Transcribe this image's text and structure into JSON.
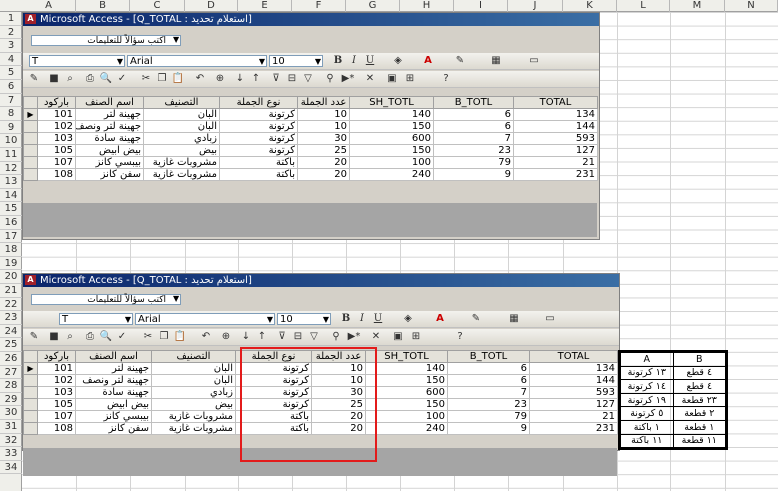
{
  "sheet": {
    "columns": [
      "A",
      "B",
      "C",
      "D",
      "E",
      "F",
      "G",
      "H",
      "I",
      "J",
      "K",
      "L",
      "M",
      "N"
    ],
    "rows": [
      "1",
      "2",
      "3",
      "4",
      "5",
      "6",
      "7",
      "8",
      "9",
      "10",
      "11",
      "12",
      "13",
      "14",
      "15",
      "16",
      "17",
      "18",
      "19",
      "20",
      "21",
      "22",
      "23",
      "24",
      "25",
      "26",
      "27",
      "28",
      "29",
      "30",
      "31",
      "32",
      "33",
      "34"
    ]
  },
  "window1": {
    "title": "Microsoft Access - [Q_TOTAL : استعلام تحديد]",
    "ask_placeholder": "اكتب سؤالاً للتعليمات",
    "font_field": "T",
    "font_name": "Arial",
    "font_size": "10",
    "headers": [
      "باركود",
      "اسم الصنف",
      "التصنيف",
      "نوع الجملة",
      "عدد الجملة",
      "SH_TOTL",
      "B_TOTL",
      "TOTAL"
    ],
    "rows": [
      [
        "101",
        "جهينة لتر",
        "البان",
        "كرتونة",
        "10",
        "140",
        "6",
        "134"
      ],
      [
        "102",
        "جهينة لتر ونصف",
        "البان",
        "كرتونة",
        "10",
        "150",
        "6",
        "144"
      ],
      [
        "103",
        "جهينة سادة",
        "زبادي",
        "كرتونة",
        "30",
        "600",
        "7",
        "593"
      ],
      [
        "105",
        "بيض ابيض",
        "بيض",
        "كرتونة",
        "25",
        "150",
        "23",
        "127"
      ],
      [
        "107",
        "بيبسي كانز",
        "مشروبات غازية",
        "باكتة",
        "20",
        "100",
        "79",
        "21"
      ],
      [
        "108",
        "سفن كانز",
        "مشروبات غازية",
        "باكتة",
        "20",
        "240",
        "9",
        "231"
      ]
    ]
  },
  "window2": {
    "title": "Microsoft Access - [Q_TOTAL : استعلام تحديد]",
    "ask_placeholder": "اكتب سؤالاً للتعليمات",
    "font_field": "T",
    "font_name": "Arial",
    "font_size": "10",
    "headers": [
      "باركود",
      "اسم الصنف",
      "التصنيف",
      "نوع الجملة",
      "عدد الجملة",
      "SH_TOTL",
      "B_TOTL",
      "TOTAL"
    ],
    "rows": [
      [
        "101",
        "جهينة لتر",
        "البان",
        "كرتونة",
        "10",
        "140",
        "6",
        "134"
      ],
      [
        "102",
        "جهينة لتر ونصف",
        "البان",
        "كرتونة",
        "10",
        "150",
        "6",
        "144"
      ],
      [
        "103",
        "جهينة سادة",
        "زبادي",
        "كرتونة",
        "30",
        "600",
        "7",
        "593"
      ],
      [
        "105",
        "بيض ابيض",
        "بيض",
        "كرتونة",
        "25",
        "150",
        "23",
        "127"
      ],
      [
        "107",
        "بيبسي كانز",
        "مشروبات غازية",
        "باكتة",
        "20",
        "100",
        "79",
        "21"
      ],
      [
        "108",
        "سفن كانز",
        "مشروبات غازية",
        "باكتة",
        "20",
        "240",
        "9",
        "231"
      ]
    ]
  },
  "summary_table": {
    "headers": [
      "A",
      "B"
    ],
    "rows": [
      [
        "١٣ كرتونة",
        "٤ قطع"
      ],
      [
        "١٤ كرتونة",
        "٤ قطع"
      ],
      [
        "١٩ كرتونة",
        "٢٣ قطعة"
      ],
      [
        "٥ كرتونة",
        "٢ قطعة"
      ],
      [
        "١ باكتة",
        "١ قطعة"
      ],
      [
        "١١ باكتة",
        "١١ قطعة"
      ]
    ]
  },
  "colors": {
    "highlight": "#e31b1b",
    "title_bar": "#0a246a"
  }
}
